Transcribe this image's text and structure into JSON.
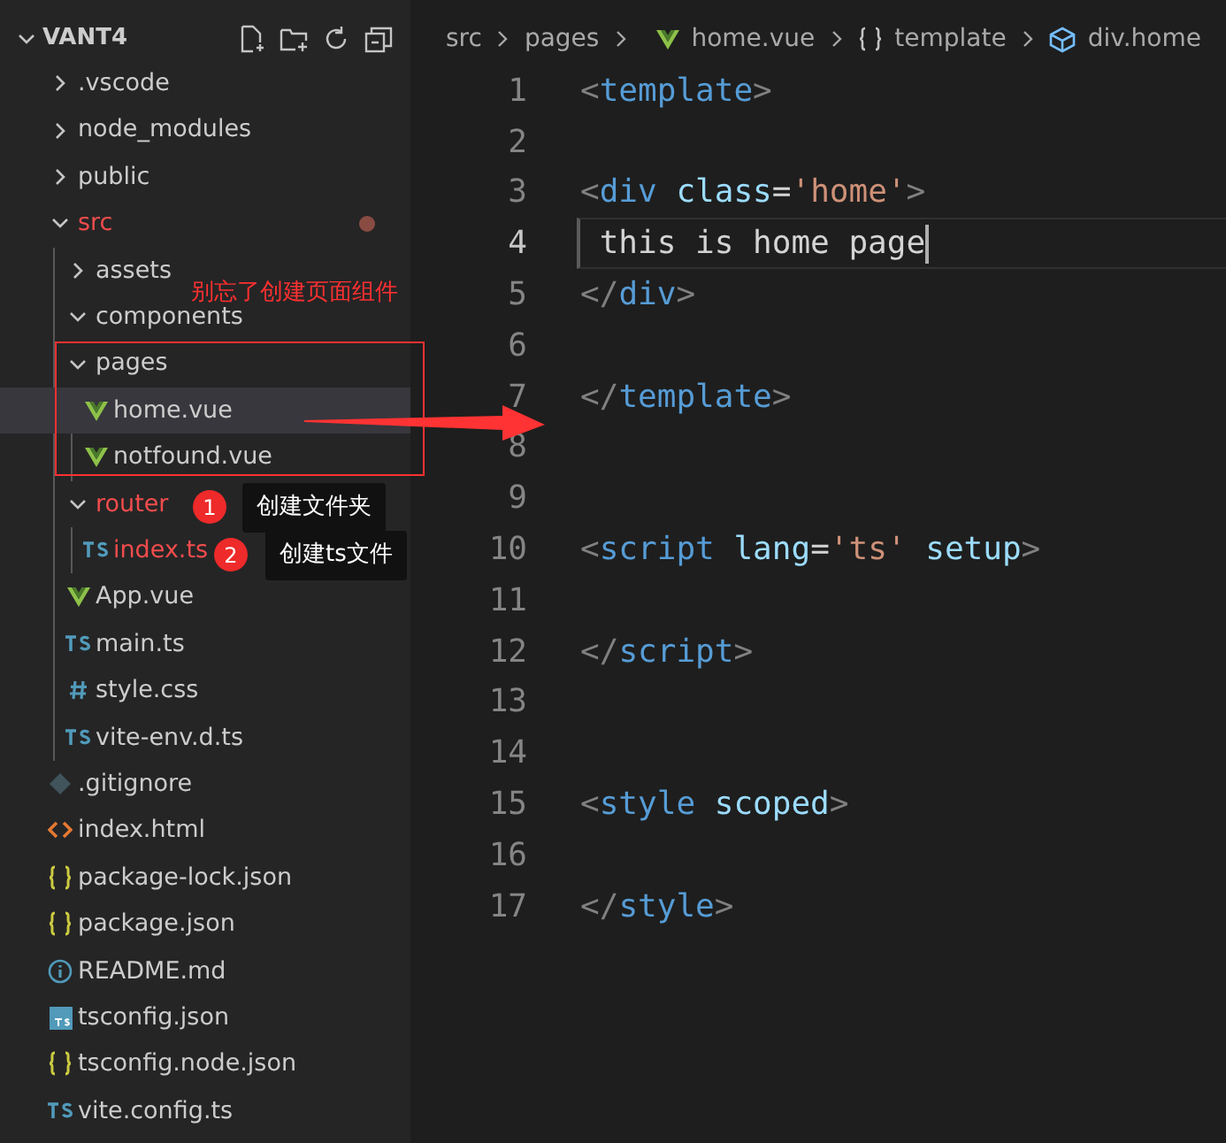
{
  "explorer": {
    "title": "VANT4",
    "expanded": true,
    "tree": [
      {
        "label": ".vscode",
        "kind": "folder",
        "expanded": false,
        "selected": false,
        "modified": false
      },
      {
        "label": "node_modules",
        "kind": "folder",
        "expanded": false,
        "selected": false,
        "modified": false
      },
      {
        "label": "public",
        "kind": "folder",
        "expanded": false,
        "selected": false,
        "modified": false
      },
      {
        "label": "src",
        "kind": "folder",
        "expanded": true,
        "selected": false,
        "modified": true,
        "changes_dot": true,
        "children": [
          {
            "label": "assets",
            "kind": "folder",
            "expanded": false,
            "selected": false,
            "modified": false
          },
          {
            "label": "components",
            "kind": "folder",
            "expanded": true,
            "selected": false,
            "modified": false
          },
          {
            "label": "pages",
            "kind": "folder",
            "expanded": true,
            "selected": false,
            "modified": false,
            "children": [
              {
                "label": "home.vue",
                "kind": "vue",
                "selected": true,
                "modified": false
              },
              {
                "label": "notfound.vue",
                "kind": "vue",
                "selected": false,
                "modified": false
              }
            ]
          },
          {
            "label": "router",
            "kind": "folder",
            "expanded": true,
            "selected": false,
            "modified": true,
            "children": [
              {
                "label": "index.ts",
                "kind": "ts",
                "selected": false,
                "modified": true
              }
            ]
          },
          {
            "label": "App.vue",
            "kind": "vue",
            "selected": false,
            "modified": false
          },
          {
            "label": "main.ts",
            "kind": "ts",
            "selected": false,
            "modified": false
          },
          {
            "label": "style.css",
            "kind": "css",
            "selected": false,
            "modified": false
          },
          {
            "label": "vite-env.d.ts",
            "kind": "ts",
            "selected": false,
            "modified": false
          }
        ]
      },
      {
        "label": ".gitignore",
        "kind": "git",
        "selected": false,
        "modified": false
      },
      {
        "label": "index.html",
        "kind": "html",
        "selected": false,
        "modified": false
      },
      {
        "label": "package-lock.json",
        "kind": "json",
        "selected": false,
        "modified": false
      },
      {
        "label": "package.json",
        "kind": "json",
        "selected": false,
        "modified": false
      },
      {
        "label": "README.md",
        "kind": "info",
        "selected": false,
        "modified": false
      },
      {
        "label": "tsconfig.json",
        "kind": "tsconfig",
        "selected": false,
        "modified": false
      },
      {
        "label": "tsconfig.node.json",
        "kind": "json",
        "selected": false,
        "modified": false
      },
      {
        "label": "vite.config.ts",
        "kind": "ts",
        "selected": false,
        "modified": false
      }
    ]
  },
  "breadcrumb": [
    {
      "label": "src",
      "kind": "plain"
    },
    {
      "label": "pages",
      "kind": "plain"
    },
    {
      "label": "home.vue",
      "kind": "vue"
    },
    {
      "label": "template",
      "kind": "braces"
    },
    {
      "label": "div.home",
      "kind": "element"
    }
  ],
  "code_lines": [
    {
      "number": "1",
      "current": false,
      "tokens": [
        {
          "text": "<",
          "kind": "punct"
        },
        {
          "text": "template",
          "kind": "tag"
        },
        {
          "text": ">",
          "kind": "punct"
        }
      ]
    },
    {
      "number": "2",
      "current": false
    },
    {
      "number": "3",
      "current": false,
      "tokens": [
        {
          "text": "<",
          "kind": "punct"
        },
        {
          "text": "div",
          "kind": "tag"
        },
        {
          "text": " class",
          "kind": "attr"
        },
        {
          "text": "=",
          "kind": "text"
        },
        {
          "text": "'home'",
          "kind": "string"
        },
        {
          "text": ">",
          "kind": "punct"
        }
      ]
    },
    {
      "number": "4",
      "current": true,
      "tokens": [
        {
          "text": " this is home page",
          "kind": "text"
        }
      ]
    },
    {
      "number": "5",
      "current": false,
      "tokens": [
        {
          "text": "</",
          "kind": "punct"
        },
        {
          "text": "div",
          "kind": "tag"
        },
        {
          "text": ">",
          "kind": "punct"
        }
      ]
    },
    {
      "number": "6",
      "current": false
    },
    {
      "number": "7",
      "current": false,
      "tokens": [
        {
          "text": "</",
          "kind": "punct"
        },
        {
          "text": "template",
          "kind": "tag"
        },
        {
          "text": ">",
          "kind": "punct"
        }
      ]
    },
    {
      "number": "8",
      "current": false
    },
    {
      "number": "9",
      "current": false
    },
    {
      "number": "10",
      "current": false,
      "tokens": [
        {
          "text": "<",
          "kind": "punct"
        },
        {
          "text": "script",
          "kind": "tag"
        },
        {
          "text": " lang",
          "kind": "attr"
        },
        {
          "text": "=",
          "kind": "text"
        },
        {
          "text": "'ts'",
          "kind": "string"
        },
        {
          "text": " setup",
          "kind": "attr"
        },
        {
          "text": ">",
          "kind": "punct"
        }
      ]
    },
    {
      "number": "11",
      "current": false
    },
    {
      "number": "12",
      "current": false,
      "tokens": [
        {
          "text": "</",
          "kind": "punct"
        },
        {
          "text": "script",
          "kind": "tag"
        },
        {
          "text": ">",
          "kind": "punct"
        }
      ]
    },
    {
      "number": "13",
      "current": false
    },
    {
      "number": "14",
      "current": false
    },
    {
      "number": "15",
      "current": false,
      "tokens": [
        {
          "text": "<",
          "kind": "punct"
        },
        {
          "text": "style",
          "kind": "tag"
        },
        {
          "text": " scoped",
          "kind": "attr"
        },
        {
          "text": ">",
          "kind": "punct"
        }
      ]
    },
    {
      "number": "16",
      "current": false
    },
    {
      "number": "17",
      "current": false,
      "tokens": [
        {
          "text": "</",
          "kind": "punct"
        },
        {
          "text": "style",
          "kind": "tag"
        },
        {
          "text": ">",
          "kind": "punct"
        }
      ]
    }
  ],
  "annotations": {
    "note": "别忘了创建页面组件",
    "callouts": [
      {
        "badge": "1",
        "text": "创建文件夹"
      },
      {
        "badge": "2",
        "text": "创建ts文件"
      }
    ]
  }
}
